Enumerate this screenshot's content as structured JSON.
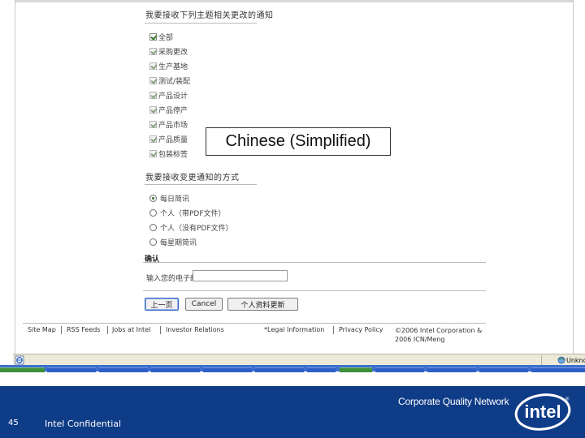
{
  "form": {
    "section1_title": "我要接收下列主题相关更改的通知",
    "checkboxes": [
      {
        "label": "全部",
        "checked": true
      },
      {
        "label": "采购更改",
        "checked": true
      },
      {
        "label": "生产基地",
        "checked": true
      },
      {
        "label": "测试/装配",
        "checked": true
      },
      {
        "label": "产品设计",
        "checked": true
      },
      {
        "label": "产品停产",
        "checked": true
      },
      {
        "label": "产品市场",
        "checked": true
      },
      {
        "label": "产品质量",
        "checked": true
      },
      {
        "label": "包装标签",
        "checked": true
      }
    ],
    "section2_title": "我要接收变更通知的方式",
    "radios": [
      {
        "label": "每日简讯",
        "selected": true
      },
      {
        "label": "个人（带PDF文件）",
        "selected": false
      },
      {
        "label": "个人（没有PDF文件）",
        "selected": false
      },
      {
        "label": "每星期简讯",
        "selected": false
      }
    ],
    "confirm_label": "确认",
    "email_label": "输入您的电子邮件",
    "email_value": "",
    "buttons": {
      "prev": "上一页",
      "cancel": "Cancel",
      "save": "个人资料更新"
    }
  },
  "footer": {
    "links": [
      "Site Map",
      "RSS Feeds",
      "Jobs at Intel",
      "Investor Relations",
      "*Legal Information",
      "Privacy Policy"
    ],
    "copyright_line1": "©2006 Intel Corporation &",
    "copyright_line2": "2006 ICN/Meng"
  },
  "language_box": "Chinese (Simplified)",
  "status_bar": {
    "zone": "Unknown"
  },
  "slide_footer": {
    "page_number": "45",
    "confidential": "Intel Confidential",
    "network_title": "Corporate Quality Network",
    "logo_text": "intel"
  },
  "colors": {
    "band": "#0f3c87",
    "taskbar": "#3d6fcf",
    "status_bar": "#ece9d8"
  }
}
